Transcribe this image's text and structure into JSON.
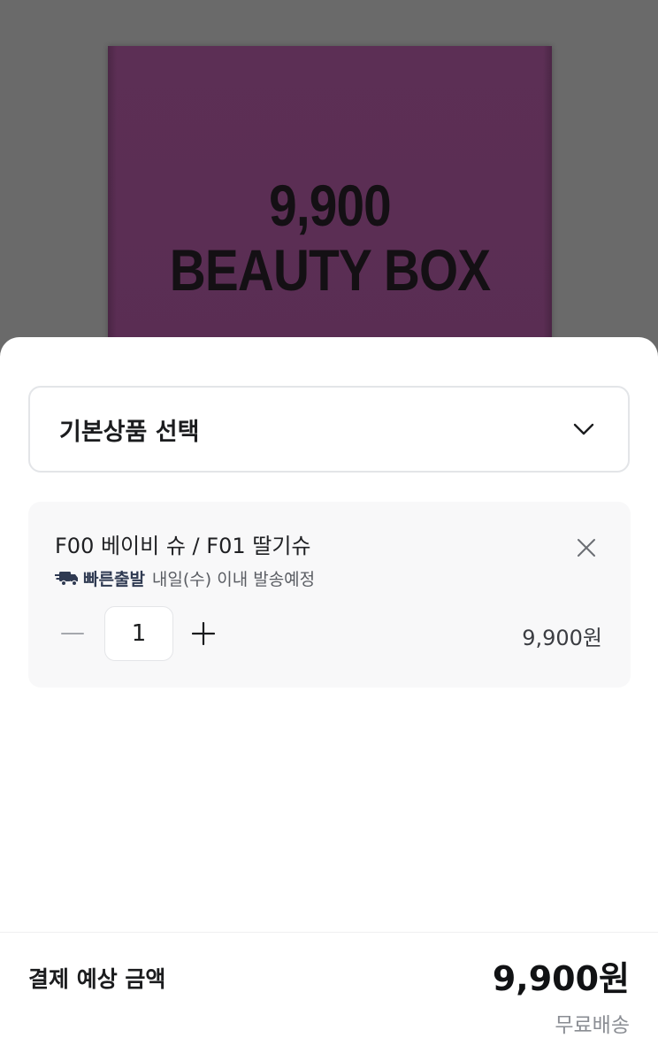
{
  "product_image": {
    "line1": "9,900",
    "line2": "BEAUTY BOX"
  },
  "option_select": {
    "label": "기본상품 선택",
    "icon": "chevron-down-icon"
  },
  "selected_item": {
    "name": "F00 베이비 슈 / F01 딸기슈",
    "shipping_badge": "빠른출발",
    "shipping_text": "내일(수) 이내 발송예정",
    "quantity": "1",
    "price": "9,900원",
    "icons": [
      "close-icon",
      "truck-icon",
      "minus-icon",
      "plus-icon"
    ]
  },
  "summary": {
    "label": "결제 예상 금액",
    "amount": "9,900원",
    "shipping": "무료배송"
  },
  "colors": {
    "box": "#5c2f55",
    "shipping_badge": "#2f3a52",
    "card_bg": "#f8f8f9"
  }
}
